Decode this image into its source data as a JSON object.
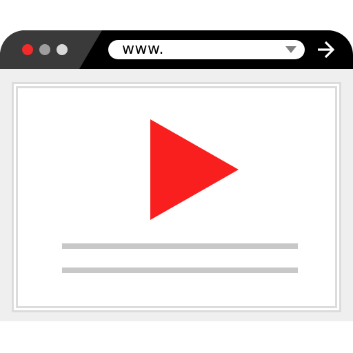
{
  "browser": {
    "window_controls": [
      {
        "name": "close",
        "color": "#f22a2a"
      },
      {
        "name": "minimize",
        "color": "#9e9e9e"
      },
      {
        "name": "maximize",
        "color": "#d9d9d9"
      }
    ],
    "address_bar": {
      "value": "www."
    },
    "icons": {
      "dropdown": "chevron-down-icon",
      "go": "arrow-right-icon"
    }
  },
  "content": {
    "video_player": {
      "play_icon": "play-icon",
      "play_color": "#f91f1f"
    },
    "text_placeholder_lines": 2
  },
  "colors": {
    "titlebar": "#000000",
    "tab": "#3a3a3a",
    "content_background": "#efefef",
    "page_border": "#dcdcdc",
    "placeholder_line": "#c8c8c8"
  }
}
